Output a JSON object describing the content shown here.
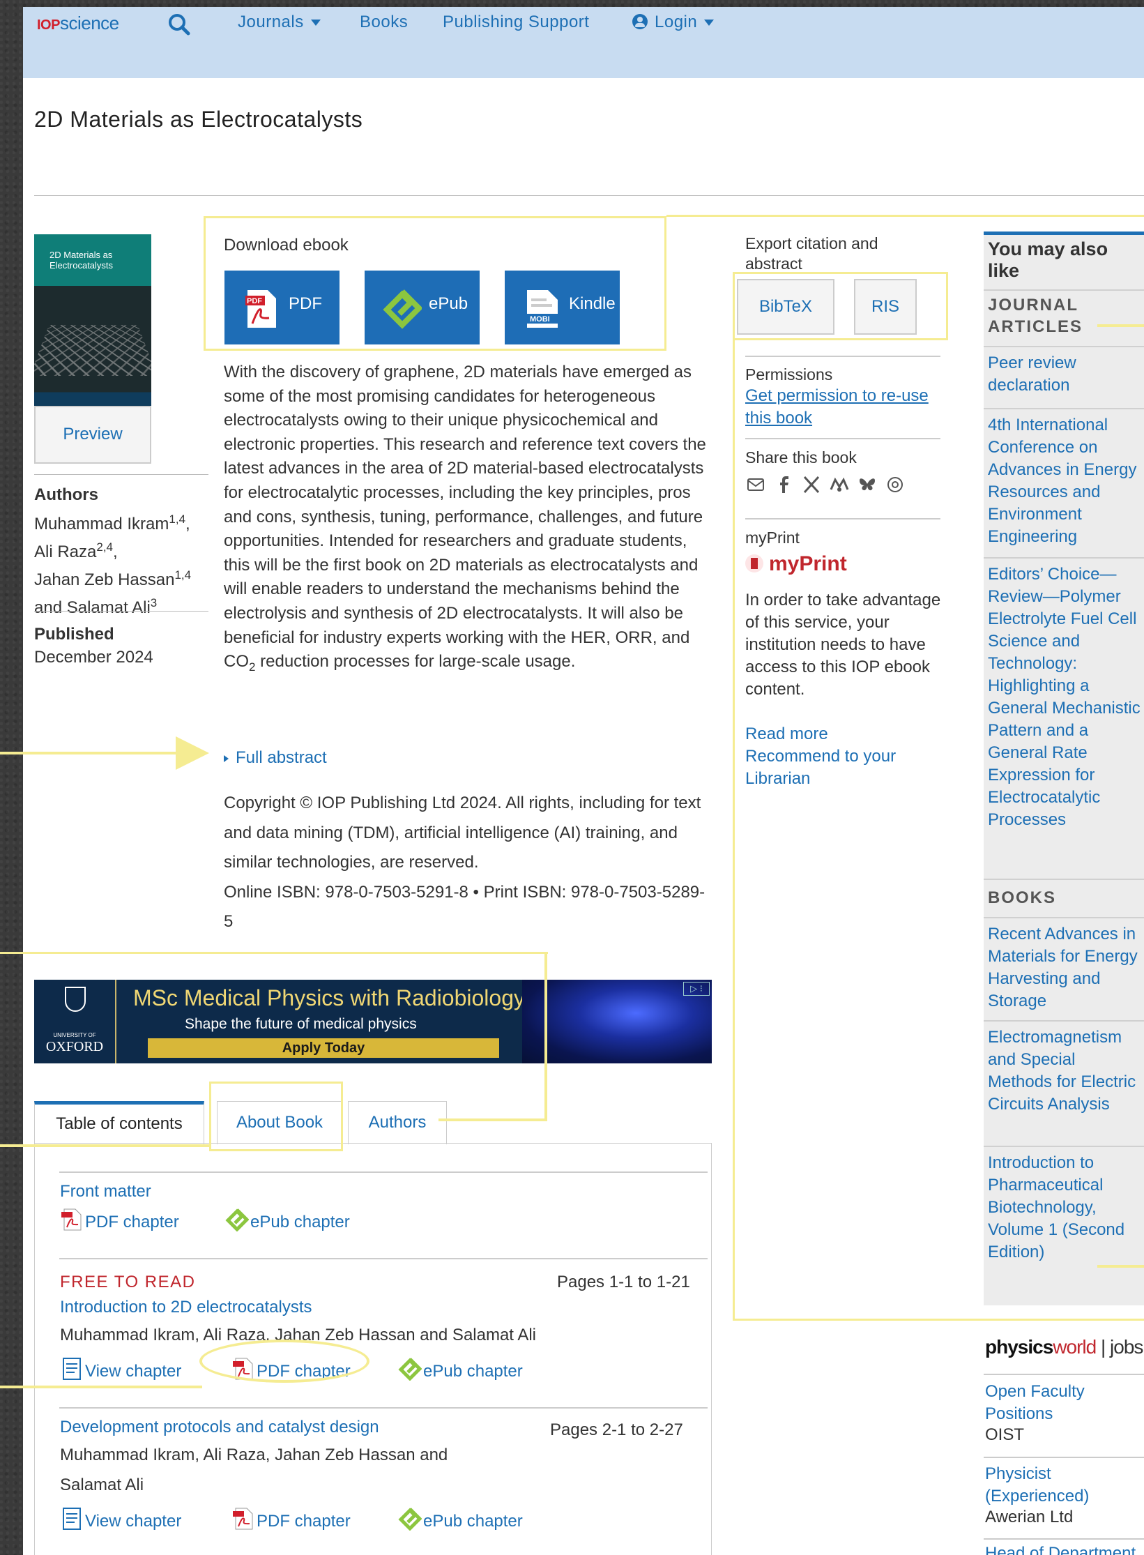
{
  "header": {
    "logo_iop": "IOP",
    "logo_science": "science",
    "nav": [
      {
        "label": "Journals"
      },
      {
        "label": "Books"
      },
      {
        "label": "Publishing Support"
      },
      {
        "label": "Login"
      }
    ]
  },
  "book": {
    "title": "2D Materials as Electrocatalysts",
    "cover_title": "2D Materials as Electrocatalysts",
    "preview_label": "Preview",
    "authors_label": "Authors",
    "authors": [
      {
        "name": "Muhammad Ikram",
        "sup": "1,4",
        "sep": ","
      },
      {
        "name": "Ali Raza",
        "sup": "2,4",
        "sep": ","
      },
      {
        "name": "Jahan Zeb Hassan",
        "sup": "1,4",
        "sep": ""
      },
      {
        "name": "and Salamat Ali",
        "sup": "3",
        "sep": ""
      }
    ],
    "published_label": "Published",
    "published_date": "December 2024"
  },
  "download": {
    "label": "Download ebook",
    "buttons": [
      {
        "label": "PDF",
        "icon": "pdf-icon"
      },
      {
        "label": "ePub",
        "icon": "epub-icon"
      },
      {
        "label": "Kindle",
        "icon": "mobi-icon"
      }
    ]
  },
  "abstract": {
    "text_before": "With the discovery of graphene, 2D materials have emerged as some of the most promising candidates for heterogeneous electrocatalysts owing to their unique physicochemical and electronic properties. This research and reference text covers the latest advances in the area of 2D material-based electrocatalysts for electrocatalytic processes, including the key principles, pros and cons, synthesis, tuning, performance, challenges, and future opportunities. Intended for researchers and graduate students, this will be the first book on 2D materials as electrocatalysts and will enable readers to understand the mechanisms behind the electrolysis and synthesis of 2D electrocatalysts. It will also be beneficial for industry experts working with the HER, ORR, and CO",
    "sub": "2",
    "text_after": " reduction processes for large-scale usage.",
    "full_abstract_label": "Full abstract"
  },
  "copyright": {
    "text": "Copyright © IOP Publishing Ltd 2024. All rights, including for text and data mining (TDM), artificial intelligence (AI) training, and similar technologies, are reserved.",
    "isbn": "Online ISBN: 978-0-7503-5291-8 • Print ISBN: 978-0-7503-5289-5"
  },
  "ad": {
    "headline": "MSc Medical Physics with Radiobiology",
    "subline": "Shape the future of medical physics",
    "cta": "Apply Today",
    "university_small": "UNIVERSITY OF",
    "university": "OXFORD"
  },
  "tabs": [
    {
      "label": "Table of contents"
    },
    {
      "label": "About Book"
    },
    {
      "label": "Authors"
    }
  ],
  "toc": {
    "front_matter": {
      "title": "Front matter",
      "pdf": "PDF chapter",
      "epub": "ePub chapter"
    },
    "chapters": [
      {
        "badge": "FREE TO READ",
        "pages": "Pages 1-1 to 1-21",
        "title": "Introduction to 2D electrocatalysts",
        "authors": "Muhammad Ikram, Ali Raza, Jahan Zeb Hassan and Salamat Ali",
        "view": "View chapter",
        "pdf": "PDF chapter",
        "epub": "ePub chapter"
      },
      {
        "pages": "Pages 2-1 to 2-27",
        "title": "Development protocols and catalyst design",
        "authors": "Muhammad Ikram, Ali Raza, Jahan Zeb Hassan and Salamat Ali",
        "view": "View chapter",
        "pdf": "PDF chapter",
        "epub": "ePub chapter"
      }
    ]
  },
  "citation": {
    "label": "Export citation and abstract",
    "bibtex": "BibTeX",
    "ris": "RIS"
  },
  "permissions": {
    "label": "Permissions",
    "link": "Get permission to re-use this book"
  },
  "share": {
    "label": "Share this book",
    "icons": [
      "email-icon",
      "facebook-icon",
      "x-icon",
      "mendeley-icon",
      "bluesky-icon",
      "threads-icon"
    ]
  },
  "myprint": {
    "label": "myPrint",
    "logo": "myPrint",
    "text": "In order to take advantage of this service, your institution needs to have access to this IOP ebook content.",
    "read_more": "Read more",
    "recommend": "Recommend to your Librarian"
  },
  "sidebar": {
    "heading": "You may also like",
    "journal_section": "JOURNAL ARTICLES",
    "journal_articles": [
      "Peer review declaration",
      "4th International Conference on Advances in Energy Resources and Environment Engineering",
      "Editors’ Choice—Review—Polymer Electrolyte Fuel Cell Science and Technology: Highlighting a General Mechanistic Pattern and a General Rate Expression for Electrocatalytic Processes"
    ],
    "books_section": "BOOKS",
    "books": [
      "Recent Advances in Materials for Energy Harvesting and Storage",
      "Electromagnetism and Special Methods for Electric Circuits Analysis",
      "Introduction to Pharmaceutical Biotechnology, Volume 1 (Second Edition)"
    ]
  },
  "jobs": {
    "logo_physics": "physics",
    "logo_world": "world",
    "logo_jobs": "jobs",
    "items": [
      {
        "title": "Open Faculty Positions",
        "org": "OIST"
      },
      {
        "title": "Physicist (Experienced)",
        "org": "Awerian Ltd"
      },
      {
        "title": "Head of Department"
      }
    ]
  },
  "colors": {
    "accent": "#1d6fb4",
    "header_bg": "#c8dcf1",
    "free_red": "#c0262d",
    "annotation": "#f5ec92"
  }
}
